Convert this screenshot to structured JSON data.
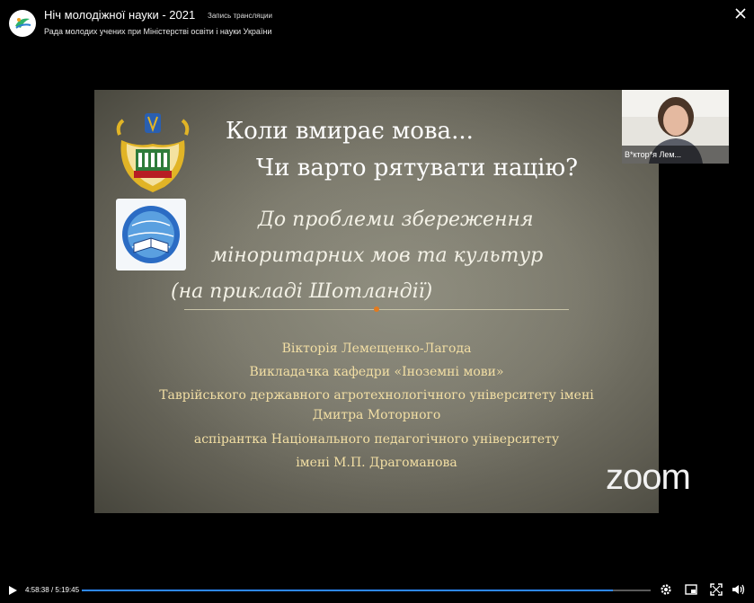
{
  "header": {
    "title": "Ніч молодіжної науки - 2021",
    "live_label": "Запись трансляции",
    "channel": "Рада молодих учених при Міністерстві освіти і науки України"
  },
  "slide": {
    "title_line1": "Коли вмирає мова...",
    "title_line2": "Чи варто рятувати націю?",
    "subtitle_line1": "До проблеми збереження",
    "subtitle_line2": "міноритарних мов та культур",
    "subtitle_line3": "(на прикладі Шотландії)",
    "author_lines": [
      "Вікторія Лемещенко-Лагода",
      "Викладачка кафедри «Іноземні мови»",
      "Таврійського державного агротехнологічного університету імені",
      "Дмитра Моторного",
      "аспірантка Національного педагогічного університету",
      "імені М.П. Драгоманова"
    ]
  },
  "participant": {
    "name": "В*ктор*я Лем..."
  },
  "zoom_logo": "zoom",
  "player": {
    "current_time": "4:58:38",
    "total_time": "5:19:45",
    "progress": 0.9336,
    "accent": "#2d88ff"
  },
  "icons": [
    "close-icon",
    "play-icon",
    "settings-icon",
    "pip-icon",
    "fullscreen-icon",
    "volume-icon"
  ]
}
